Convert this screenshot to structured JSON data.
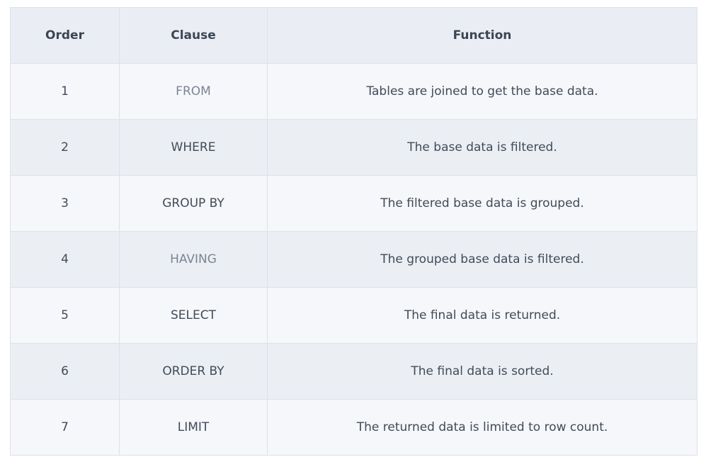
{
  "table": {
    "headers": [
      "Order",
      "Clause",
      "Function"
    ],
    "rows": [
      {
        "order": "1",
        "clause": "FROM",
        "function": "Tables are joined to get the base data."
      },
      {
        "order": "2",
        "clause": "WHERE",
        "function": "The base data is filtered."
      },
      {
        "order": "3",
        "clause": "GROUP BY",
        "function": "The filtered base data is grouped."
      },
      {
        "order": "4",
        "clause": "HAVING",
        "function": "The grouped base data is filtered."
      },
      {
        "order": "5",
        "clause": "SELECT",
        "function": "The final data is returned."
      },
      {
        "order": "6",
        "clause": "ORDER BY",
        "function": "The final data is sorted."
      },
      {
        "order": "7",
        "clause": "LIMIT",
        "function": "The returned data is limited to row count."
      }
    ]
  }
}
